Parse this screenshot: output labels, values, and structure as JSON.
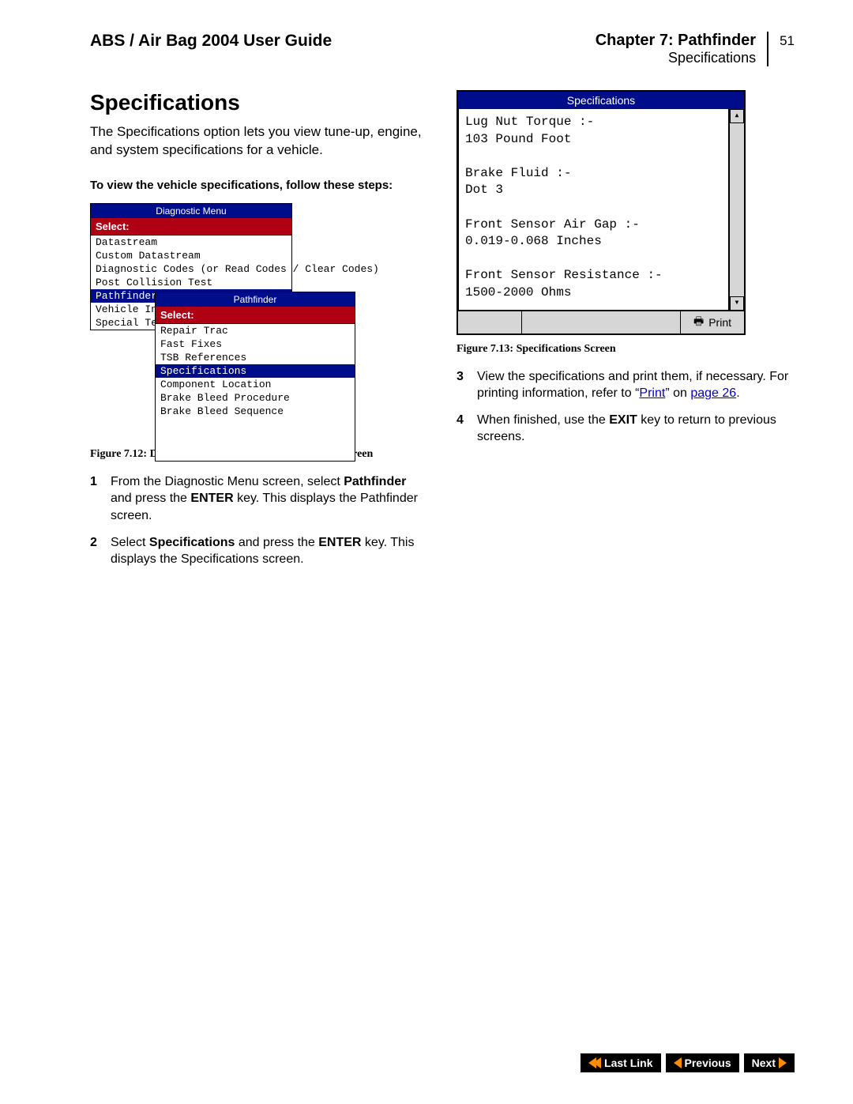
{
  "header": {
    "guide_title": "ABS / Air Bag 2004 User Guide",
    "chapter": "Chapter 7: Pathfinder",
    "section": "Specifications",
    "page_number": "51"
  },
  "left": {
    "h1": "Specifications",
    "intro": "The Specifications option lets you view tune-up, engine, and system specifications for a vehicle.",
    "lead": "To view the vehicle specifications, follow these steps:",
    "diagnostic_menu": {
      "title": "Diagnostic Menu",
      "select_label": "Select:",
      "items": [
        {
          "label": "Datastream",
          "highlight": false
        },
        {
          "label": "Custom Datastream",
          "highlight": false
        },
        {
          "label": "Diagnostic Codes (or Read Codes / Clear Codes)",
          "highlight": false
        },
        {
          "label": "Post Collision Test",
          "highlight": false
        },
        {
          "label": "Pathfinder",
          "highlight": true
        },
        {
          "label": "Vehicle Info",
          "highlight": false
        },
        {
          "label": "Special Tests",
          "highlight": false
        }
      ]
    },
    "pathfinder_menu": {
      "title": "Pathfinder",
      "select_label": "Select:",
      "items": [
        {
          "label": "Repair Trac",
          "highlight": false
        },
        {
          "label": "Fast Fixes",
          "highlight": false
        },
        {
          "label": "TSB References",
          "highlight": false
        },
        {
          "label": "Specifications",
          "highlight": true
        },
        {
          "label": "Component Location",
          "highlight": false
        },
        {
          "label": "Brake Bleed Procedure",
          "highlight": false
        },
        {
          "label": "Brake Bleed Sequence",
          "highlight": false
        }
      ]
    },
    "figure_caption": "Figure 7.12: Diagnostic Menu Screen and Pathfinder Screen",
    "steps": [
      {
        "n": "1",
        "html": "From the Diagnostic Menu screen, select <b>Pathfinder</b> and press the <b>ENTER</b> key. This displays the Pathfinder screen."
      },
      {
        "n": "2",
        "html": "Select <b>Specifications</b> and press the <b>ENTER</b> key. This displays the Specifications screen."
      }
    ]
  },
  "right": {
    "spec_screen": {
      "title": "Specifications",
      "lines": "Lug Nut Torque :-\n103 Pound Foot\n\nBrake Fluid :-\nDot 3\n\nFront Sensor Air Gap :-\n0.019-0.068 Inches\n\nFront Sensor Resistance :-\n1500-2000 Ohms",
      "print_label": "Print"
    },
    "figure_caption": "Figure 7.13: Specifications Screen",
    "steps": [
      {
        "n": "3",
        "html": "View the specifications and print them, if necessary. For printing information, refer to “<a class='lnk' data-name='print-link' data-interactable='true'>Print</a>” on <a class='lnk' data-name='page-26-link' data-interactable='true'>page 26</a>."
      },
      {
        "n": "4",
        "html": "When finished, use the <b>EXIT</b> key to return to previous screens."
      }
    ],
    "link_texts": {
      "print": "Print",
      "page": "page 26"
    }
  },
  "nav": {
    "last_link": "Last Link",
    "previous": "Previous",
    "next": "Next"
  }
}
